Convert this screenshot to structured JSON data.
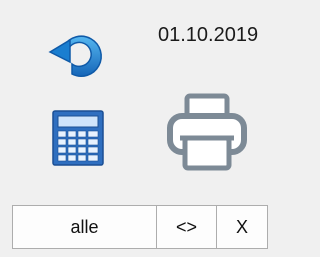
{
  "header": {
    "date": "01.10.2019"
  },
  "toolbar": {
    "icons": [
      "refresh-icon",
      "calculator-icon",
      "printer-icon"
    ]
  },
  "buttons": {
    "all_label": "alle",
    "nav_label": "<>",
    "close_label": "X"
  },
  "colors": {
    "refresh_blue": "#1e8ad6",
    "calculator_blue": "#3a78c8",
    "printer_gray": "#7d8a96",
    "background": "#f0f0f0"
  }
}
